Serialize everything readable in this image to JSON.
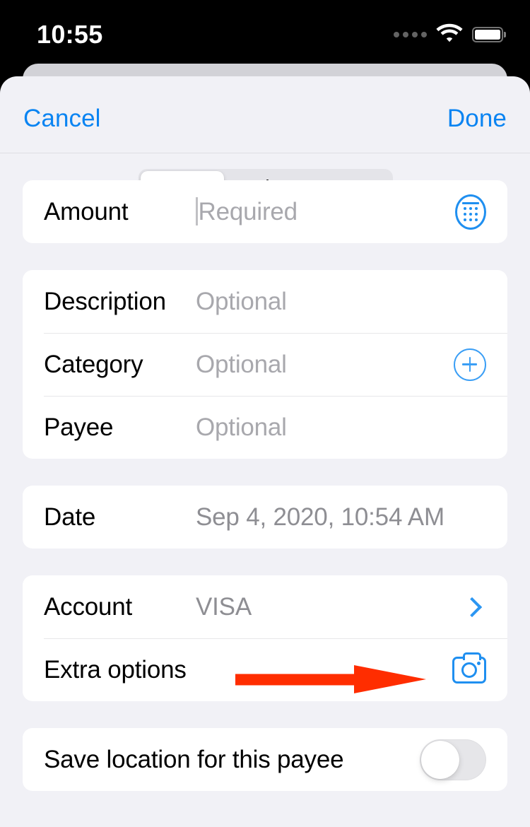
{
  "status_bar": {
    "time": "10:55",
    "signal_icon": "signal-dots-icon",
    "wifi_icon": "wifi-icon",
    "battery_icon": "battery-full-icon"
  },
  "toolbar": {
    "cancel_label": "Cancel",
    "done_label": "Done",
    "segmented_control": {
      "selected_index": 0,
      "options": [
        {
          "id": "expense",
          "icon": "minus-icon"
        },
        {
          "id": "income",
          "icon": "plus-icon"
        },
        {
          "id": "transfer",
          "icon": "left-right-arrow-icon"
        }
      ]
    }
  },
  "form": {
    "amount": {
      "label": "Amount",
      "placeholder": "Required",
      "value": "",
      "accessory_icon": "calculator-icon",
      "focused": true
    },
    "description": {
      "label": "Description",
      "placeholder": "Optional",
      "value": ""
    },
    "category": {
      "label": "Category",
      "placeholder": "Optional",
      "value": "",
      "accessory_icon": "plus-circle-icon"
    },
    "payee": {
      "label": "Payee",
      "placeholder": "Optional",
      "value": ""
    },
    "date": {
      "label": "Date",
      "value": "Sep 4, 2020, 10:54 AM"
    },
    "account": {
      "label": "Account",
      "value": "VISA",
      "accessory_icon": "chevron-right-icon"
    },
    "extra_options": {
      "label": "Extra options",
      "accessory_icon": "camera-icon"
    },
    "save_location": {
      "label": "Save location for this payee",
      "toggle_state": "off"
    }
  },
  "annotation": {
    "type": "arrow",
    "color": "#ff2d00",
    "points_to": "camera-icon"
  },
  "colors": {
    "accent_blue": "#0a84f2",
    "icon_blue": "#1f8ff0",
    "placeholder_gray": "#a8a8ad",
    "value_gray": "#8e8e93",
    "sheet_background": "#f1f1f6",
    "card_background": "#ffffff",
    "annotation_red": "#ff2d00"
  }
}
